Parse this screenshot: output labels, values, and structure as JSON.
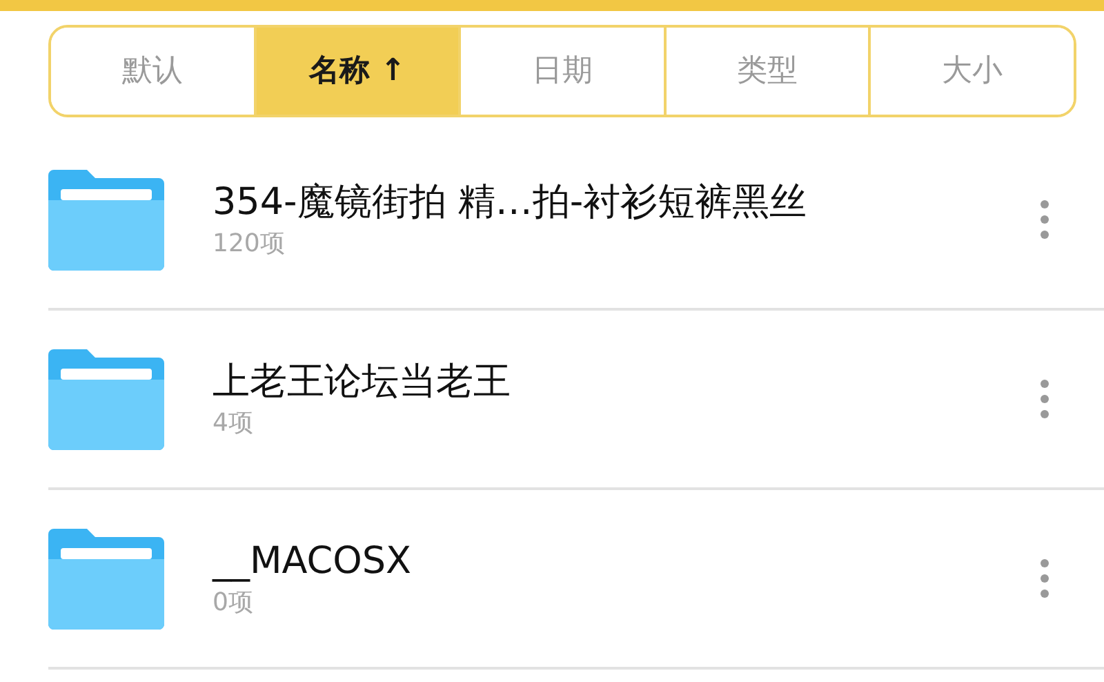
{
  "sort_tabs": [
    {
      "label": "默认",
      "selected": false
    },
    {
      "label": "名称 ↑",
      "selected": true
    },
    {
      "label": "日期",
      "selected": false
    },
    {
      "label": "类型",
      "selected": false
    },
    {
      "label": "大小",
      "selected": false
    }
  ],
  "files": [
    {
      "name": "354-魔镜街拍 精…拍-衬衫短裤黑丝",
      "count": "120项"
    },
    {
      "name": "上老王论坛当老王",
      "count": "4项"
    },
    {
      "name": "__MACOSX",
      "count": "0项"
    }
  ]
}
